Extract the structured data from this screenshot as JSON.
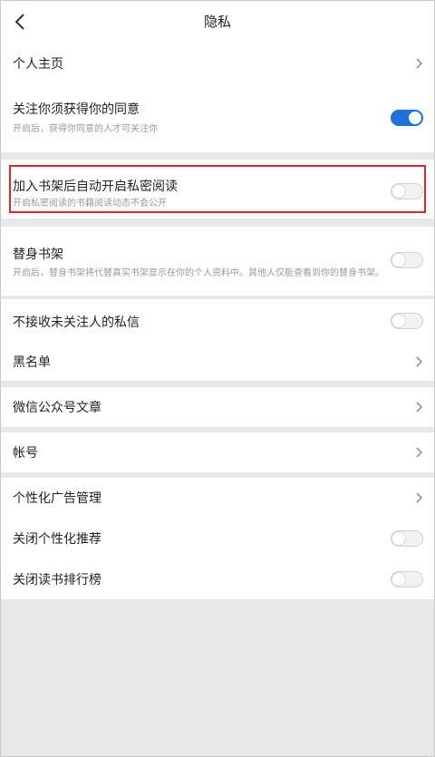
{
  "header": {
    "title": "隐私",
    "back_icon": "chevron-left-icon"
  },
  "rows": {
    "profile": {
      "label": "个人主页"
    },
    "follow_consent": {
      "label": "关注你须获得你的同意",
      "sub": "开启后，获得你同意的人才可关注你",
      "on": true
    },
    "private_reading": {
      "label": "加入书架后自动开启私密阅读",
      "sub": "开启私密阅读的书籍阅读动态不会公开",
      "on": false
    },
    "proxy_shelf": {
      "label": "替身书架",
      "sub": "开启后，替身书架将代替真实书架显示在你的个人资料中。其他人仅能查看到你的替身书架。",
      "on": false
    },
    "no_stranger_msg": {
      "label": "不接收未关注人的私信",
      "on": false
    },
    "blacklist": {
      "label": "黑名单"
    },
    "wechat_articles": {
      "label": "微信公众号文章"
    },
    "account": {
      "label": "帐号"
    },
    "ad_management": {
      "label": "个性化广告管理"
    },
    "close_recommend": {
      "label": "关闭个性化推荐",
      "on": false
    },
    "close_ranking": {
      "label": "关闭读书排行榜",
      "on": false
    }
  },
  "colors": {
    "accent": "#1f6fdc",
    "highlight": "#e0262a",
    "background": "#e8e8ea"
  }
}
